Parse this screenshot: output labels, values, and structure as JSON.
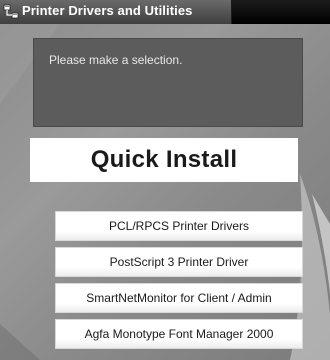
{
  "window": {
    "title": "Printer Drivers and Utilities",
    "title_icon": "printer-network-icon"
  },
  "message": {
    "text": "Please make a selection."
  },
  "quick_install": {
    "label": "Quick Install"
  },
  "utilities": [
    {
      "label": "PCL/RPCS Printer Drivers"
    },
    {
      "label": "PostScript 3 Printer Driver"
    },
    {
      "label": "SmartNetMonitor for Client / Admin"
    },
    {
      "label": "Agfa Monotype Font Manager 2000"
    }
  ]
}
